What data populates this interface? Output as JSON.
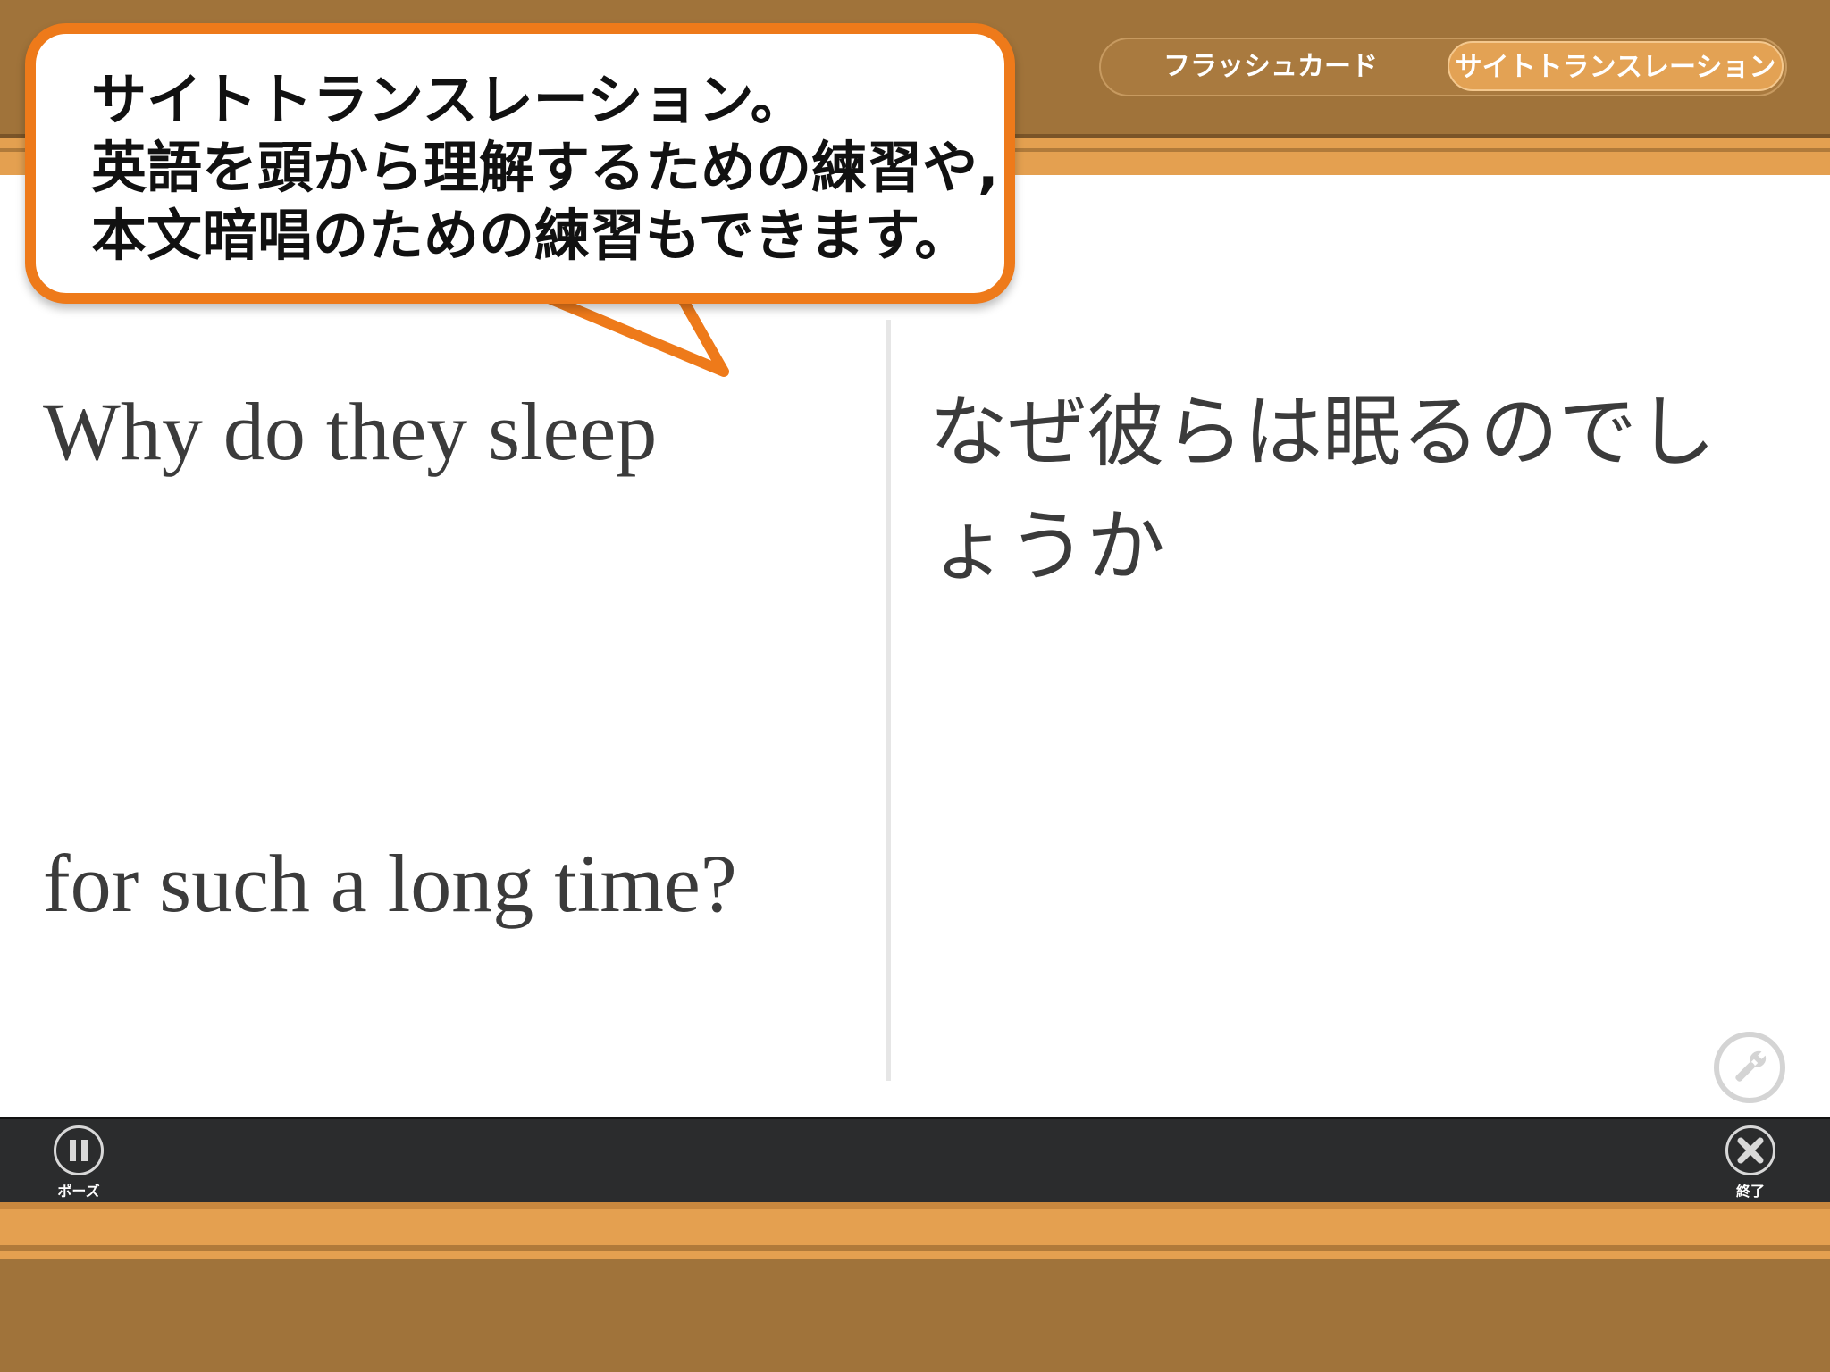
{
  "header": {
    "mode_tabs": [
      {
        "label": "フラッシュカード",
        "selected": false
      },
      {
        "label": "サイトトランスレーション",
        "selected": true
      }
    ]
  },
  "callout": {
    "lines": [
      "サイトトランスレーション。",
      "英語を頭から理解するための練習や,",
      "本文暗唱のための練習もできます。"
    ]
  },
  "card": {
    "english_lines": [
      "Why do they sleep",
      "for such a long time?"
    ],
    "japanese_text": "なぜ彼らは眠るのでしょうか"
  },
  "controls": {
    "pause_label": "ポーズ",
    "exit_label": "終了",
    "settings_icon": "wrench-icon"
  },
  "colors": {
    "brown": "#a0733a",
    "orange_stripe": "#e4a050",
    "callout_border": "#ee7a1a",
    "bottom_bar": "#2b2c2d"
  }
}
